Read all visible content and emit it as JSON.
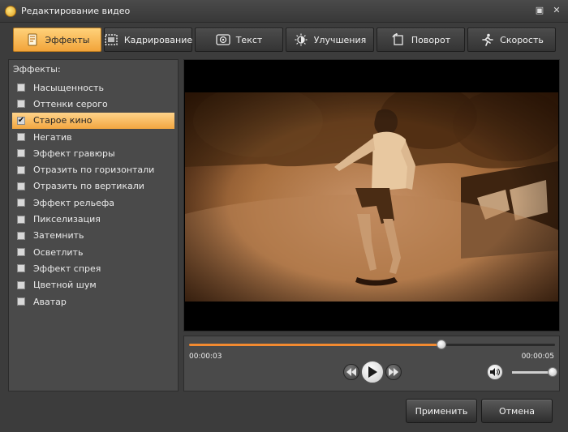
{
  "window": {
    "title": "Редактирование видео",
    "restore_glyph": "▣",
    "close_glyph": "✕"
  },
  "tabs": [
    {
      "label": "Эффекты",
      "icon": "effects-icon",
      "active": true
    },
    {
      "label": "Кадрирование",
      "icon": "crop-icon",
      "active": false
    },
    {
      "label": "Текст",
      "icon": "text-icon",
      "active": false
    },
    {
      "label": "Улучшения",
      "icon": "brightness-icon",
      "active": false
    },
    {
      "label": "Поворот",
      "icon": "rotate-icon",
      "active": false
    },
    {
      "label": "Скорость",
      "icon": "running-icon",
      "active": false
    }
  ],
  "effects_panel": {
    "heading": "Эффекты:",
    "items": [
      {
        "label": "Насыщенность",
        "checked": false
      },
      {
        "label": "Оттенки серого",
        "checked": false
      },
      {
        "label": "Старое кино",
        "checked": true
      },
      {
        "label": "Негатив",
        "checked": false
      },
      {
        "label": "Эффект гравюры",
        "checked": false
      },
      {
        "label": "Отразить по горизонтали",
        "checked": false
      },
      {
        "label": "Отразить по вертикали",
        "checked": false
      },
      {
        "label": "Эффект рельефа",
        "checked": false
      },
      {
        "label": "Пикселизация",
        "checked": false
      },
      {
        "label": "Затемнить",
        "checked": false
      },
      {
        "label": "Осветлить",
        "checked": false
      },
      {
        "label": "Эффект спрея",
        "checked": false
      },
      {
        "label": "Цветной шум",
        "checked": false
      },
      {
        "label": "Аватар",
        "checked": false
      }
    ]
  },
  "player": {
    "current_time": "00:00:03",
    "total_time": "00:00:05",
    "progress": 0.69,
    "volume": 0.96
  },
  "buttons": {
    "apply": "Применить",
    "cancel": "Отмена"
  },
  "colors": {
    "accent": "#f2a43a",
    "progress": "#f28a30"
  }
}
